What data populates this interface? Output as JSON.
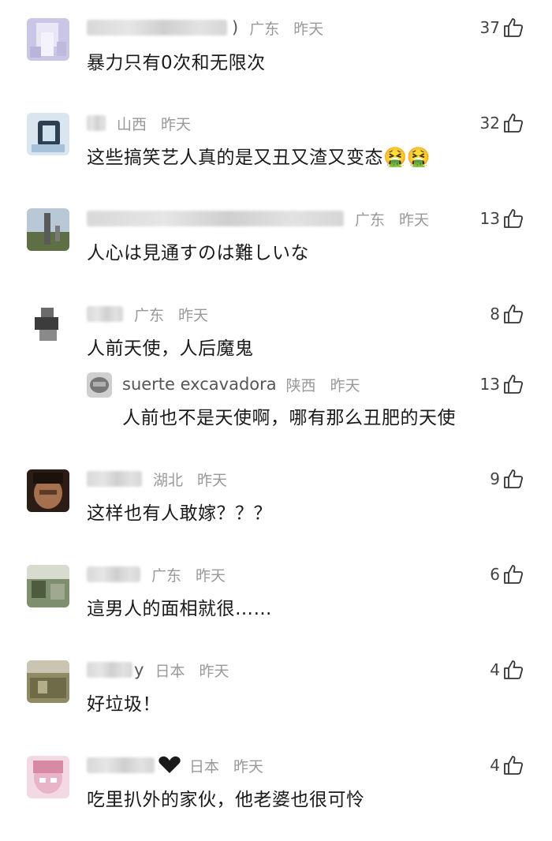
{
  "comments": [
    {
      "username_tail": ")",
      "region": "广东",
      "time": "昨天",
      "likes": "37",
      "text": "暴力只有0次和无限次"
    },
    {
      "region": "山西",
      "time": "昨天",
      "likes": "32",
      "text": "这些搞笑艺人真的是又丑又渣又变态",
      "emoji": "🤮🤮"
    },
    {
      "region": "广东",
      "time": "昨天",
      "likes": "13",
      "text": "人心は見通すのは難しいな"
    },
    {
      "region": "广东",
      "time": "昨天",
      "likes": "8",
      "text": "人前天使，人后魔鬼",
      "reply": {
        "username": "suerte excavadora",
        "region": "陕西",
        "time": "昨天",
        "likes": "13",
        "text": "人前也不是天使啊，哪有那么丑肥的天使"
      }
    },
    {
      "region": "湖北",
      "time": "昨天",
      "likes": "9",
      "text": "这样也有人敢嫁？？？"
    },
    {
      "region": "广东",
      "time": "昨天",
      "likes": "6",
      "text": "這男人的面相就很……"
    },
    {
      "username_tail": "y",
      "region": "日本",
      "time": "昨天",
      "likes": "4",
      "text": "好垃圾！"
    },
    {
      "region": "日本",
      "time": "昨天",
      "likes": "4",
      "text": "吃里扒外的家伙，他老婆也很可怜"
    }
  ],
  "icons": {
    "like": "thumbs-up-icon",
    "vomit_emoji": "face-vomiting-emoji"
  },
  "colors": {
    "meta": "#999999",
    "text": "#1a1a1a",
    "background": "#ffffff"
  }
}
